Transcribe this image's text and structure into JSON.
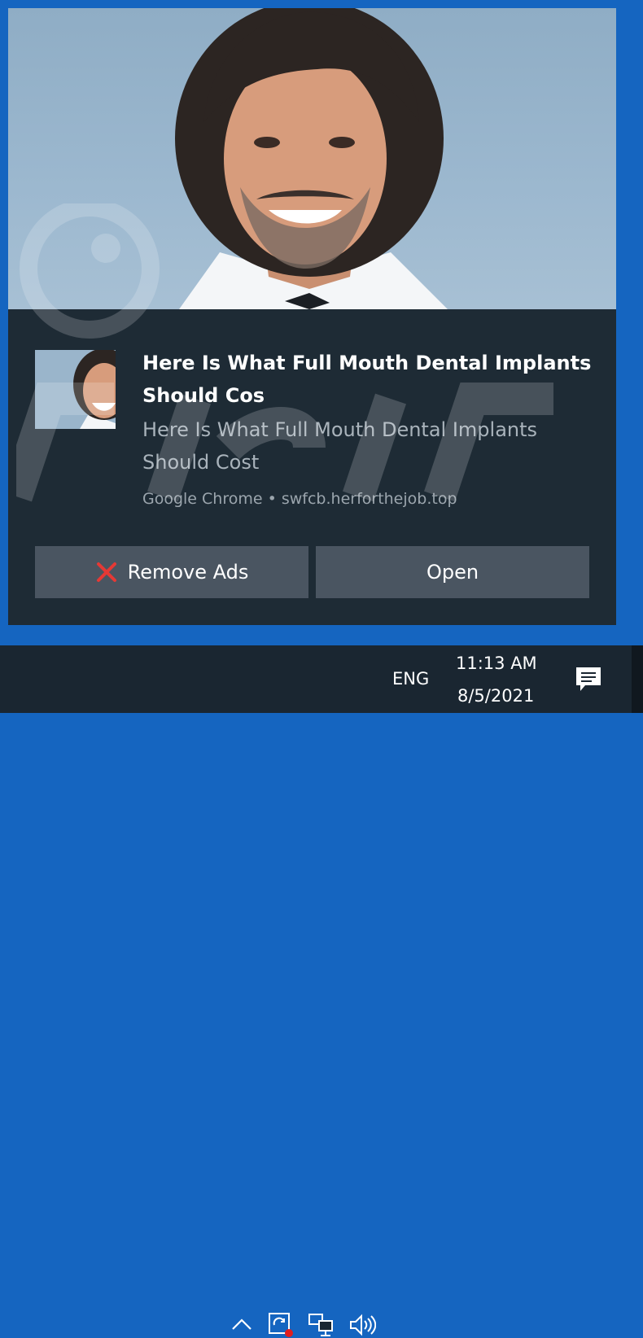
{
  "notification": {
    "title": "Here Is What Full Mouth Dental Implants Should Cos",
    "body": "Here Is What Full Mouth Dental Implants Should Cost",
    "attribution": "Google Chrome • swfcb.herforthejob.top",
    "buttons": {
      "remove_ads": "Remove Ads",
      "open": "Open"
    }
  },
  "taskbar": {
    "language": "ENG",
    "time": "11:13 AM",
    "date": "8/5/2021"
  },
  "colors": {
    "desktop": "#1565c0",
    "toast_bg": "#1e2b35",
    "button_bg": "#4a5561",
    "taskbar_bg": "#1a2631",
    "remove_icon": "#e53935"
  },
  "icons": [
    "close-x-icon",
    "chevron-up-icon",
    "sync-alert-icon",
    "network-icon",
    "volume-icon",
    "notifications-icon"
  ]
}
